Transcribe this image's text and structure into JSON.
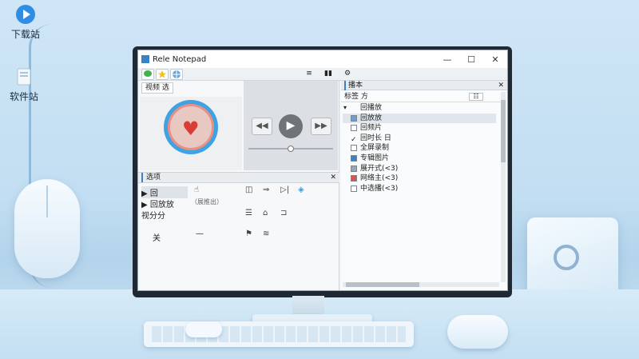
{
  "desktop": {
    "icons": [
      {
        "label": "下载站",
        "icon": "download-app-icon"
      },
      {
        "label": "软件站",
        "icon": "software-app-icon"
      }
    ]
  },
  "window": {
    "title": "Rele Notepad",
    "buttons": {
      "minimize": "—",
      "maximize": "☐",
      "close": "✕"
    }
  },
  "player": {
    "tab": "视频 选",
    "heart": "♥",
    "prev": "◀◀",
    "play": "▶",
    "next": "▶▶",
    "progress": 0.5
  },
  "options": {
    "tab": "选项",
    "close": "✕",
    "rows": [
      {
        "label": "▶ 回",
        "extra": ""
      },
      {
        "label": "▶ 回放放",
        "extra": "（展推出）"
      },
      {
        "label": "视分分",
        "extra": ""
      },
      {
        "label": "关",
        "extra": "—"
      }
    ]
  },
  "sidebar": {
    "title": "播本",
    "close": "✕",
    "filter_label": "标签 方",
    "filter_btn": "☷",
    "items": [
      {
        "label": "回播放",
        "expand": "▾",
        "checked": true,
        "highlight": true
      },
      {
        "label": "回放放",
        "expand": "",
        "checked": false,
        "highlight": false
      },
      {
        "label": "回频片",
        "expand": "",
        "checked": false,
        "highlight": false
      },
      {
        "label": "回时长 日",
        "expand": "",
        "checked": false,
        "highlight": false
      },
      {
        "label": "全屏录制",
        "expand": "",
        "checked": false,
        "highlight": false
      },
      {
        "label": "专辑图片",
        "expand": "",
        "checked": false,
        "highlight": false
      },
      {
        "label": "展开式(<3)",
        "expand": "",
        "checked": false,
        "highlight": false
      },
      {
        "label": "网络主(<3)",
        "expand": "",
        "checked": false,
        "highlight": false
      },
      {
        "label": "中选播(<3)",
        "expand": "",
        "checked": false,
        "highlight": false
      }
    ],
    "tree_header": "回播放"
  }
}
